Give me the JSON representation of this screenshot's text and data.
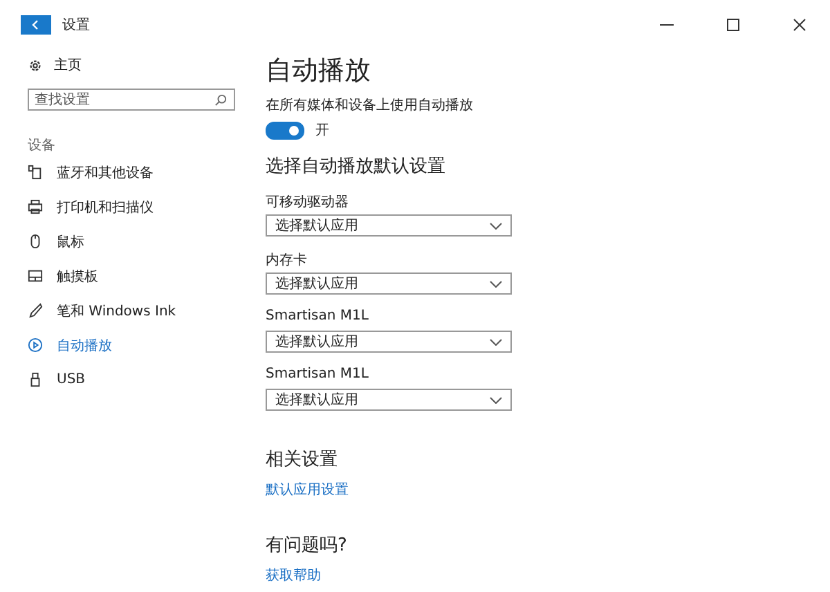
{
  "window": {
    "title": "设置"
  },
  "sidebar": {
    "home": "主页",
    "search": {
      "placeholder": "查找设置"
    },
    "section": "设备",
    "items": [
      {
        "label": "蓝牙和其他设备",
        "selected": false
      },
      {
        "label": "打印机和扫描仪",
        "selected": false
      },
      {
        "label": "鼠标",
        "selected": false
      },
      {
        "label": "触摸板",
        "selected": false
      },
      {
        "label": "笔和 Windows Ink",
        "selected": false
      },
      {
        "label": "自动播放",
        "selected": true
      },
      {
        "label": "USB",
        "selected": false
      }
    ]
  },
  "main": {
    "title": "自动播放",
    "toggle": {
      "label": "在所有媒体和设备上使用自动播放",
      "on": true,
      "state": "开"
    },
    "defaults_heading": "选择自动播放默认设置",
    "dropdowns": [
      {
        "label": "可移动驱动器",
        "value": "选择默认应用"
      },
      {
        "label": "内存卡",
        "value": "选择默认应用"
      },
      {
        "label": "Smartisan M1L",
        "value": "选择默认应用"
      },
      {
        "label": "Smartisan M1L",
        "value": "选择默认应用"
      }
    ],
    "related_heading": "相关设置",
    "related_link": "默认应用设置",
    "help_heading": "有问题吗?",
    "help_link": "获取帮助"
  }
}
